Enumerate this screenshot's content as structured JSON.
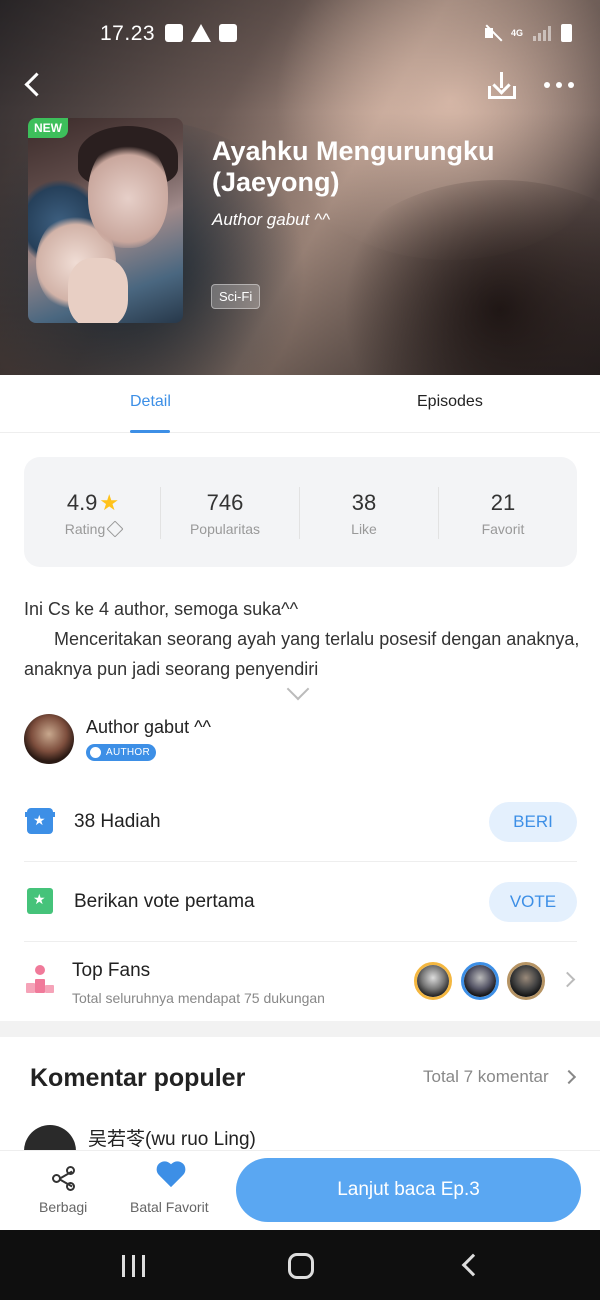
{
  "status_bar": {
    "time": "17.23",
    "network": "4G"
  },
  "header": {
    "badge": "NEW",
    "title": "Ayahku Mengurungku (Jaeyong)",
    "author": "Author gabut ^^",
    "genre": "Sci-Fi",
    "icons": [
      "back-icon",
      "download-icon",
      "more-icon"
    ]
  },
  "tabs": [
    {
      "label": "Detail",
      "active": true
    },
    {
      "label": "Episodes",
      "active": false
    }
  ],
  "stats": [
    {
      "value": "4.9",
      "label": "Rating"
    },
    {
      "value": "746",
      "label": "Popularitas"
    },
    {
      "value": "38",
      "label": "Like"
    },
    {
      "value": "21",
      "label": "Favorit"
    }
  ],
  "synopsis": {
    "line1": "Ini Cs ke 4 author, semoga suka^^",
    "line2": "Menceritakan seorang ayah yang terlalu posesif dengan anaknya, anaknya pun jadi seorang penyendiri"
  },
  "author_row": {
    "name": "Author gabut ^^",
    "badge": "AUTHOR"
  },
  "gift_row": {
    "text": "38  Hadiah",
    "button": "BERI"
  },
  "vote_row": {
    "text": "Berikan vote pertama",
    "button": "VOTE"
  },
  "fans": {
    "title": "Top Fans",
    "subtitle": "Total seluruhnya mendapat 75 dukungan"
  },
  "comments": {
    "title": "Komentar populer",
    "total": "Total 7 komentar",
    "first_user": "吴若苓(wu ruo Ling)"
  },
  "bottom_bar": {
    "share_label": "Berbagi",
    "favorite_label": "Batal Favorit",
    "cta": "Lanjut baca Ep.3"
  },
  "colors": {
    "accent": "#3d8fe6",
    "new_badge": "#3dbf5b",
    "star": "#ffc21a"
  }
}
